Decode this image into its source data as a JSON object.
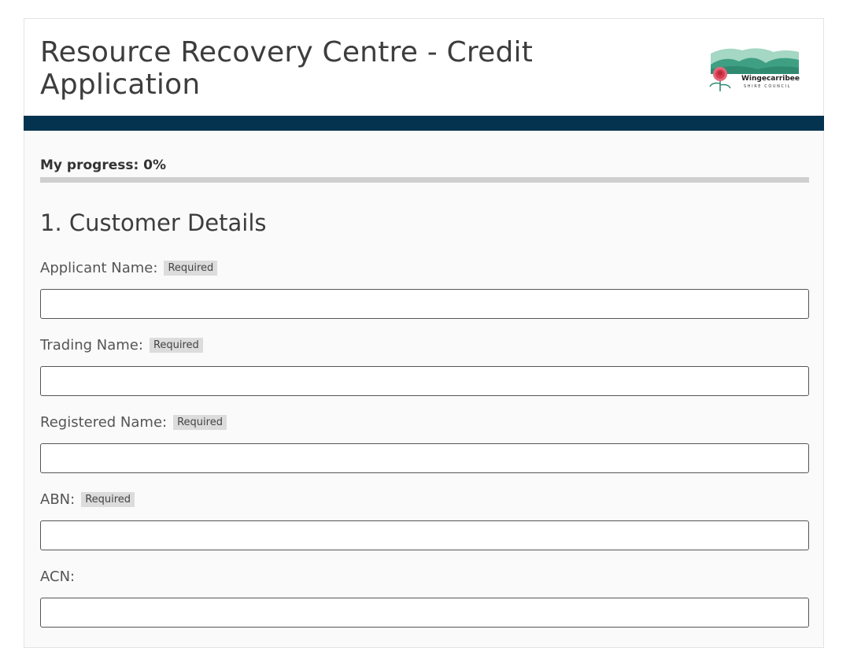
{
  "header": {
    "title": "Resource Recovery Centre - Credit Application",
    "logo": {
      "name": "Wingecarribee",
      "subtitle": "SHIRE COUNCIL",
      "icon": "waratah-flower-hills-logo"
    }
  },
  "colors": {
    "band": "#04334f",
    "track": "#cfcfcf",
    "logo_hill_dark": "#3f9f83",
    "logo_hill_light": "#a4d7c4",
    "logo_flower": "#d93a4e"
  },
  "progress": {
    "label": "My progress: 0%",
    "value": 0
  },
  "section": {
    "title": "1. Customer Details"
  },
  "required_badge": "Required",
  "fields": [
    {
      "label": "Applicant Name:",
      "required": true,
      "value": ""
    },
    {
      "label": "Trading Name:",
      "required": true,
      "value": ""
    },
    {
      "label": "Registered Name:",
      "required": true,
      "value": ""
    },
    {
      "label": "ABN:",
      "required": true,
      "value": ""
    },
    {
      "label": "ACN:",
      "required": false,
      "value": ""
    }
  ]
}
